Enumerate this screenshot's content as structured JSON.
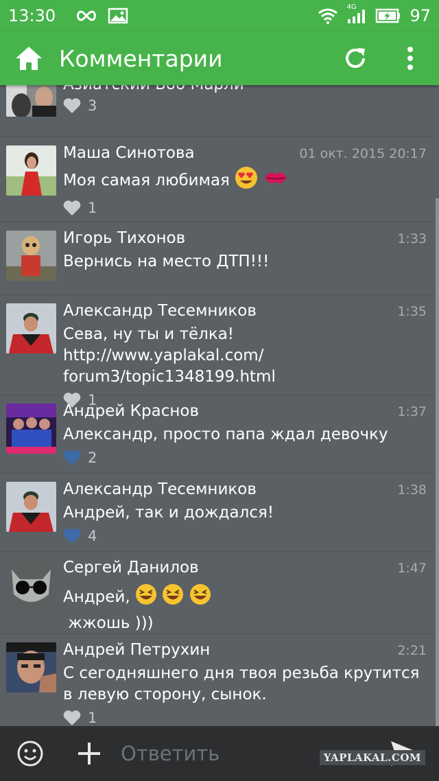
{
  "status_bar": {
    "time": "13:30",
    "battery": "97",
    "network": "4G",
    "icons": [
      "infinity-icon",
      "image-icon",
      "wifi-icon",
      "signal-icon",
      "battery-charging-icon"
    ]
  },
  "app_bar": {
    "title": "Комментарии",
    "icons": [
      "home-icon",
      "refresh-icon",
      "more-vertical-icon"
    ]
  },
  "colors": {
    "primary": "#47b34b",
    "background": "#5b6065",
    "bottom_bar": "#2c2e30",
    "like_gray": "#c8cacc",
    "like_blue": "#3d6aa8"
  },
  "comments": [
    {
      "author": "Азиатский Боб Марли",
      "time": "",
      "text": "",
      "likes": "3",
      "liked": false
    },
    {
      "author": "Маша Синотова",
      "time": "01 окт. 2015 20:17",
      "text": "Моя самая любимая",
      "emoji": [
        "heart-eyes-emoji",
        "kiss-lips-emoji"
      ],
      "likes": "1",
      "liked": false
    },
    {
      "author": "Игорь Тихонов",
      "time": "1:33",
      "text": "Вернись на место ДТП!!!",
      "likes": "",
      "liked": false
    },
    {
      "author": "Александр Тесемников",
      "time": "1:35",
      "text": "Сева, ну ты и тёлка! http://www.yaplakal.com/ forum3/topic1348199.html",
      "likes": "1",
      "liked": false
    },
    {
      "author": "Андрей Краснов",
      "time": "1:37",
      "text": "Александр, просто папа ждал девочку",
      "likes": "2",
      "liked": true
    },
    {
      "author": "Александр Тесемников",
      "time": "1:38",
      "text": "Андрей, так и дождался!",
      "likes": "4",
      "liked": true
    },
    {
      "author": "Сергей Данилов",
      "time": "1:47",
      "text": "Андрей,",
      "text2": " жжошь )))",
      "emoji": [
        "laughing-emoji",
        "laughing-emoji",
        "laughing-emoji"
      ],
      "likes": "",
      "liked": false
    },
    {
      "author": "Андрей Петрухин",
      "time": "2:21",
      "text": "С сегодняшнего дня твоя резьба крутится в левую сторону, сынок.",
      "likes": "1",
      "liked": false
    }
  ],
  "reply": {
    "placeholder": "Ответить",
    "icons": [
      "smiley-icon",
      "plus-icon",
      "send-icon"
    ]
  },
  "watermark": "YAPLAKAL.COM"
}
